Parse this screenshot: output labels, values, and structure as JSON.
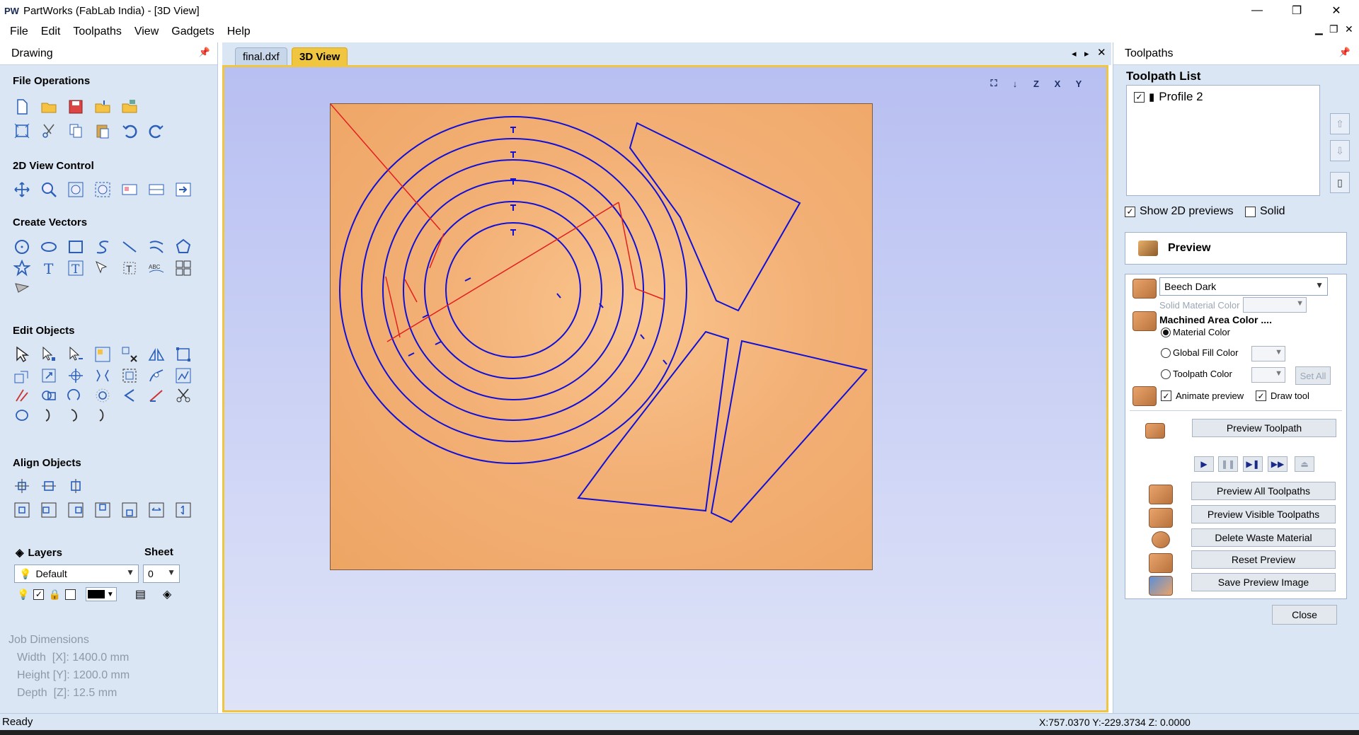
{
  "app": {
    "logo": "PW",
    "title": "PartWorks (FabLab India) - [3D View]"
  },
  "window_controls": {
    "minimize": "—",
    "restore": "❐",
    "close": "✕"
  },
  "menu": [
    "File",
    "Edit",
    "Toolpaths",
    "View",
    "Gadgets",
    "Help"
  ],
  "left_panel": {
    "header": "Drawing",
    "sections": {
      "file_operations": "File Operations",
      "view_control": "2D View Control",
      "create_vectors": "Create Vectors",
      "edit_objects": "Edit Objects",
      "align_objects": "Align Objects"
    },
    "layers": {
      "label": "Layers",
      "sheet_label": "Sheet",
      "layer_value": "Default",
      "sheet_value": "0"
    },
    "job_dimensions": {
      "title": "Job Dimensions",
      "width": "Width  [X]: 1400.0 mm",
      "height": "Height [Y]: 1200.0 mm",
      "depth": "Depth  [Z]: 12.5 mm"
    }
  },
  "tabs": [
    "final.dxf",
    "3D View"
  ],
  "view_icons": [
    "⛶",
    "↓",
    "Z",
    "X",
    "Y"
  ],
  "right_panel": {
    "header": "Toolpaths",
    "list_title": "Toolpath List",
    "toolpaths": [
      "Profile 2"
    ],
    "show_2d_previews": "Show 2D previews",
    "solid": "Solid",
    "preview_title": "Preview",
    "material": "Beech Dark",
    "solid_material_color": "Solid Material Color",
    "machined_area_color": "Machined Area Color ....",
    "material_color": "Material Color",
    "global_fill_color": "Global Fill Color",
    "toolpath_color": "Toolpath Color",
    "set_all": "Set All",
    "animate_preview": "Animate preview",
    "draw_tool": "Draw tool",
    "preview_toolpath": "Preview Toolpath",
    "preview_all": "Preview All Toolpaths",
    "preview_visible": "Preview Visible Toolpaths",
    "delete_waste": "Delete Waste Material",
    "reset_preview": "Reset Preview",
    "save_preview_image": "Save Preview Image",
    "close": "Close"
  },
  "status": {
    "left": "Ready",
    "coords": "X:757.0370 Y:-229.3734 Z: 0.0000"
  },
  "colors": {
    "panel": "#dbe6f4",
    "active_tab": "#f0c53f",
    "vector_blue": "#1010d8",
    "vector_red": "#e02020"
  }
}
